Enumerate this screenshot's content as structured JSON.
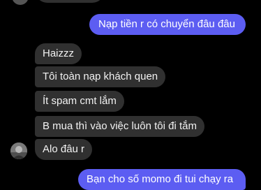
{
  "conversation": {
    "messages": [
      {
        "direction": "outgoing",
        "text": "Nạp tiền r có chuyển đâu đâu"
      },
      {
        "direction": "incoming",
        "text": "Haizzz"
      },
      {
        "direction": "incoming",
        "text": "Tôi toàn nạp khách quen"
      },
      {
        "direction": "incoming",
        "text": "Ít spam cmt lắm"
      },
      {
        "direction": "incoming",
        "text": "B mua thì vào việc luôn tôi đi tắm"
      },
      {
        "direction": "incoming",
        "text": "Alo đâu r"
      },
      {
        "direction": "outgoing",
        "text": "Bạn cho số momo đi tui chạy ra"
      }
    ]
  },
  "colors": {
    "background": "#000000",
    "incoming_bubble": "#303030",
    "outgoing_bubble": "#5c5df2",
    "text": "#ffffff"
  },
  "icons": [
    "contact-avatar-icon"
  ]
}
